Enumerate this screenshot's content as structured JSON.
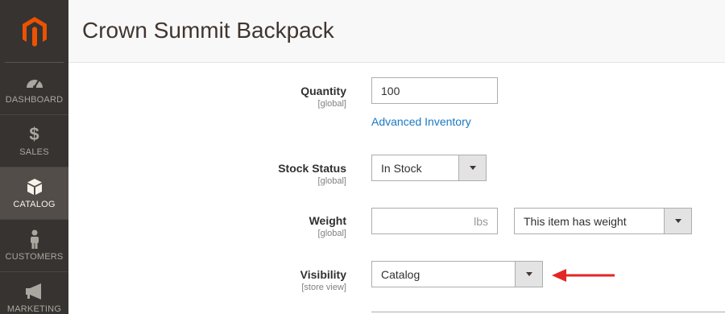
{
  "header": {
    "title": "Crown Summit Backpack"
  },
  "sidebar": {
    "items": [
      {
        "label": "DASHBOARD",
        "icon": "dashboard-icon"
      },
      {
        "label": "SALES",
        "icon": "dollar-icon"
      },
      {
        "label": "CATALOG",
        "icon": "cube-icon",
        "active": true
      },
      {
        "label": "CUSTOMERS",
        "icon": "person-icon"
      },
      {
        "label": "MARKETING",
        "icon": "megaphone-icon"
      }
    ]
  },
  "form": {
    "quantity": {
      "label": "Quantity",
      "scope": "[global]",
      "value": "100"
    },
    "advanced_inventory": {
      "label": "Advanced Inventory"
    },
    "stock_status": {
      "label": "Stock Status",
      "scope": "[global]",
      "value": "In Stock"
    },
    "weight": {
      "label": "Weight",
      "scope": "[global]",
      "value": "",
      "unit": "lbs",
      "type_value": "This item has weight"
    },
    "visibility": {
      "label": "Visibility",
      "scope": "[store view]",
      "value": "Catalog"
    }
  },
  "colors": {
    "sidebar_bg": "#373330",
    "sidebar_active": "#524d49",
    "logo_orange": "#eb5202",
    "link_blue": "#1979c3",
    "arrow_red": "#e22626"
  }
}
